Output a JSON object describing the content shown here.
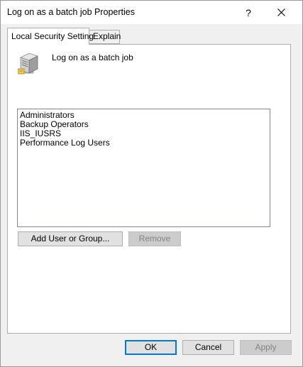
{
  "window": {
    "title": "Log on as a batch job Properties",
    "help_glyph": "?",
    "close_glyph": "✕"
  },
  "tabs": [
    {
      "label": "Local Security Setting",
      "active": true
    },
    {
      "label": "Explain",
      "active": false
    }
  ],
  "policy": {
    "name": "Log on as a batch job",
    "icon": "server-icon"
  },
  "members": [
    "Administrators",
    "Backup Operators",
    "IIS_IUSRS",
    "Performance Log Users"
  ],
  "actions": {
    "add_label": "Add User or Group...",
    "remove_label": "Remove"
  },
  "footer": {
    "ok_label": "OK",
    "cancel_label": "Cancel",
    "apply_label": "Apply"
  },
  "colors": {
    "accent": "#0078d7",
    "dialog_bg": "#f0f0f0",
    "disabled_text": "#838383"
  }
}
